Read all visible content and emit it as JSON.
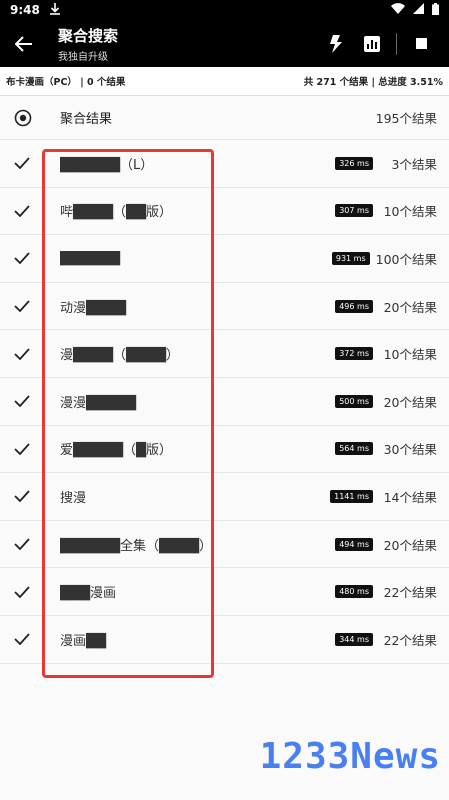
{
  "statusbar": {
    "time": "9:48"
  },
  "toolbar": {
    "title": "聚合搜索",
    "subtitle": "我独自升级"
  },
  "progress": {
    "left": "布卡漫画（PC） | 0 个结果",
    "right": "共 271 个结果 | 总进度 3.51%"
  },
  "aggregate": {
    "label": "聚合结果",
    "count": "195个结果"
  },
  "sources": [
    {
      "name": "██████（L）",
      "time": "326 ms",
      "count": "3个结果"
    },
    {
      "name": "哔████（██版）",
      "time": "307 ms",
      "count": "10个结果"
    },
    {
      "name": "██████",
      "time": "931 ms",
      "count": "100个结果"
    },
    {
      "name": "动漫████",
      "time": "496 ms",
      "count": "20个结果"
    },
    {
      "name": "漫████（████）",
      "time": "372 ms",
      "count": "10个结果"
    },
    {
      "name": "漫漫█████",
      "time": "500 ms",
      "count": "20个结果"
    },
    {
      "name": "爱█████（█版）",
      "time": "564 ms",
      "count": "30个结果"
    },
    {
      "name": "搜漫",
      "time": "1141 ms",
      "count": "14个结果"
    },
    {
      "name": "██████全集（████）",
      "time": "494 ms",
      "count": "20个结果"
    },
    {
      "name": "███漫画",
      "time": "480 ms",
      "count": "22个结果"
    },
    {
      "name": "漫画██",
      "time": "344 ms",
      "count": "22个结果"
    }
  ],
  "watermark": "1233News",
  "colors": {
    "accent": "#e53935",
    "toolbar": "#000000",
    "watermark": "#4a7ff0"
  }
}
